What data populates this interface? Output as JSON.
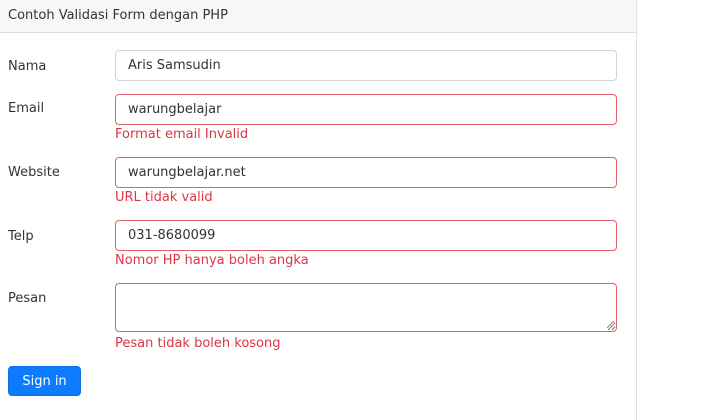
{
  "card": {
    "title": "Contoh Validasi Form dengan PHP"
  },
  "form": {
    "nama": {
      "label": "Nama",
      "value": "Aris Samsudin"
    },
    "email": {
      "label": "Email",
      "value": "warungbelajar",
      "error": "Format email Invalid"
    },
    "website": {
      "label": "Website",
      "value": "warungbelajar.net",
      "error": "URL tidak valid"
    },
    "telp": {
      "label": "Telp",
      "value": "031-8680099",
      "error": "Nomor HP hanya boleh angka"
    },
    "pesan": {
      "label": "Pesan",
      "value": "",
      "error": "Pesan tidak boleh kosong"
    },
    "submit_label": "Sign in"
  },
  "colors": {
    "error": "#dc3545",
    "invalid_border": "#e4606d",
    "primary": "#0d7bff"
  }
}
